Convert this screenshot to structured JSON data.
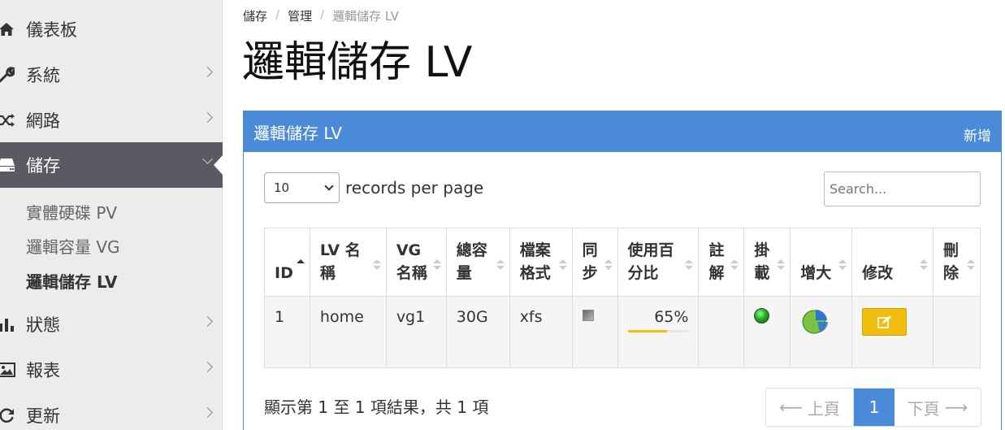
{
  "sidebar": {
    "items": [
      {
        "label": "儀表板",
        "icon": "home-icon"
      },
      {
        "label": "系統",
        "icon": "wrench-icon"
      },
      {
        "label": "網路",
        "icon": "shuffle-icon"
      },
      {
        "label": "儲存",
        "icon": "hdd-icon"
      },
      {
        "label": "狀態",
        "icon": "bar-chart-icon"
      },
      {
        "label": "報表",
        "icon": "image-icon"
      },
      {
        "label": "更新",
        "icon": "refresh-icon"
      }
    ],
    "submenu": [
      {
        "label": "實體硬碟 PV"
      },
      {
        "label": "邏輯容量 VG"
      },
      {
        "label": "邏輯儲存 LV"
      }
    ]
  },
  "breadcrumb": [
    "儲存",
    "管理",
    "邏輯儲存 LV"
  ],
  "page_title": "邏輯儲存 LV",
  "panel": {
    "title": "邏輯儲存 LV",
    "action": "新增"
  },
  "controls": {
    "per_page_value": "10",
    "per_page_label": "records per page",
    "search_placeholder": "Search..."
  },
  "table": {
    "columns": [
      "ID",
      "LV 名稱",
      "VG 名稱",
      "總容量",
      "檔案格式",
      "同步",
      "使用百分比",
      "註解",
      "掛載",
      "增大",
      "修改",
      "刪除"
    ],
    "rows": [
      {
        "id": "1",
        "lv_name": "home",
        "vg_name": "vg1",
        "size": "30G",
        "format": "xfs",
        "usage": "65%",
        "usage_fraction": 0.65,
        "comment": ""
      }
    ]
  },
  "summary": "顯示第 1 至 1 項結果，共 1 項",
  "pagination": {
    "prev": "上頁",
    "current": "1",
    "next": "下頁"
  },
  "colors": {
    "primary": "#4a8ad8",
    "warning": "#f0bd10",
    "sidebar_active": "#5a5a62"
  }
}
